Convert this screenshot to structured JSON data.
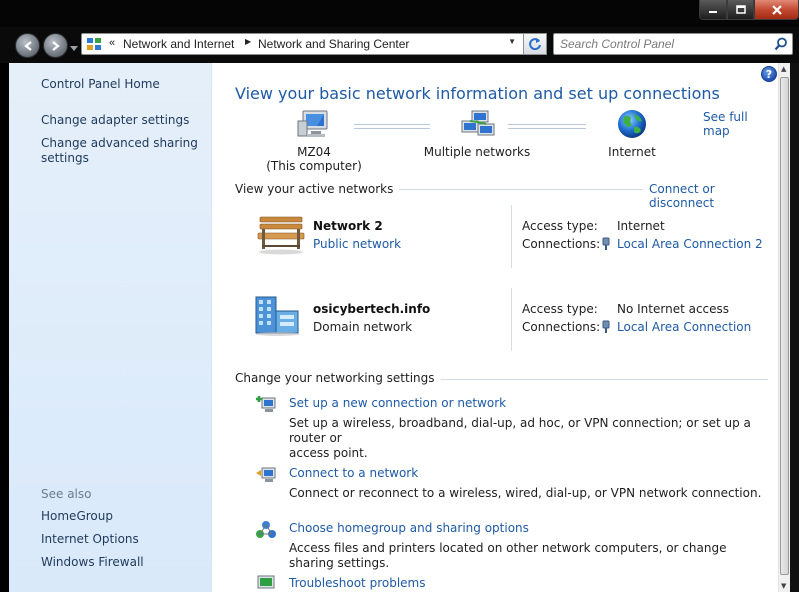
{
  "address": {
    "crumbs": [
      "Network and Internet",
      "Network and Sharing Center"
    ]
  },
  "search": {
    "placeholder": "Search Control Panel"
  },
  "left_pane": {
    "links": [
      "Control Panel Home",
      "Change adapter settings",
      "Change advanced sharing",
      "settings"
    ],
    "see_also_label": "See also",
    "see_also": [
      "HomeGroup",
      "Internet Options",
      "Windows Firewall"
    ]
  },
  "main": {
    "title": "View your basic network information and set up connections",
    "see_full_map": "See full map",
    "map": {
      "computer_name": "MZ04",
      "computer_sub": "(This computer)",
      "middle": "Multiple networks",
      "internet": "Internet"
    },
    "active_label": "View your active networks",
    "connect_disconnect": "Connect or disconnect",
    "networks": [
      {
        "name": "Network  2",
        "kind": "Public network",
        "access_label": "Access type:",
        "access_value": "Internet",
        "connections_label": "Connections:",
        "connection": "Local Area Connection 2"
      },
      {
        "name": "osicybertech.info",
        "kind": "Domain network",
        "access_label": "Access type:",
        "access_value": "No Internet access",
        "connections_label": "Connections:",
        "connection": "Local Area Connection"
      }
    ],
    "settings_label": "Change your networking settings",
    "tasks": [
      {
        "title": "Set up a new connection or network",
        "desc_line1": "Set up a wireless, broadband, dial-up, ad hoc, or VPN connection; or set up a router or",
        "desc_line2": "access point."
      },
      {
        "title": "Connect to a network",
        "desc_line1": "Connect or reconnect to a wireless, wired, dial-up, or VPN network connection.",
        "desc_line2": ""
      },
      {
        "title": "Choose homegroup and sharing options",
        "desc_line1": "Access files and printers located on other network computers, or change sharing settings.",
        "desc_line2": ""
      },
      {
        "title": "Troubleshoot problems",
        "desc_line1": "",
        "desc_line2": ""
      }
    ]
  },
  "colors": {
    "link": "#1e5aa6",
    "left_pane_bg": "#dcebfb",
    "window_frame": "#050505"
  }
}
